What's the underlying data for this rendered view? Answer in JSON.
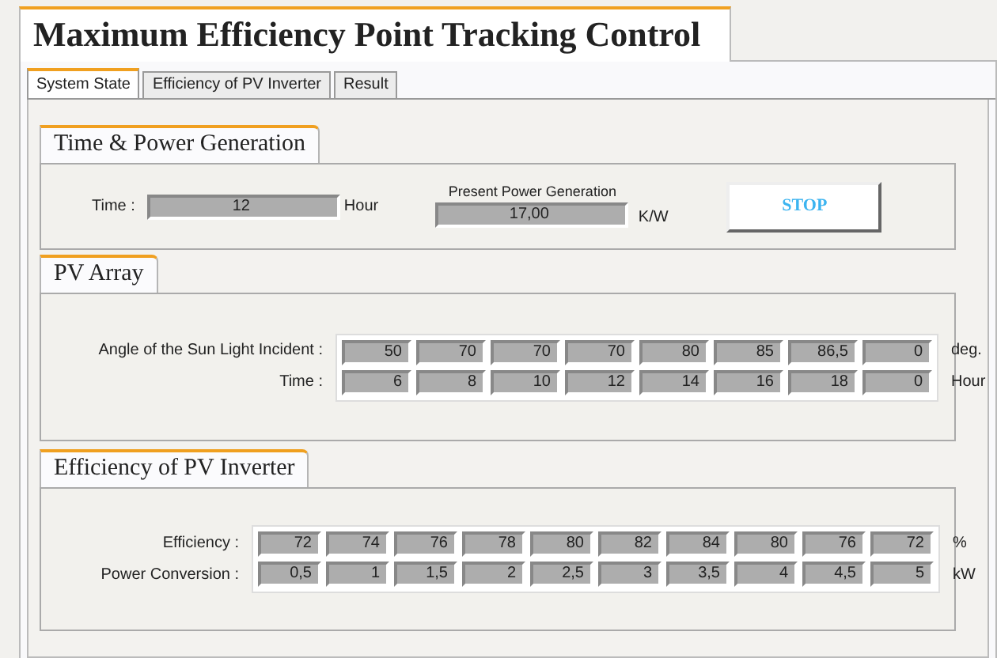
{
  "window": {
    "title": "Maximum Efficiency Point Tracking Control"
  },
  "tabs": [
    {
      "label": "System State",
      "selected": true
    },
    {
      "label": "Efficiency of PV Inverter",
      "selected": false
    },
    {
      "label": "Result",
      "selected": false
    }
  ],
  "time_power": {
    "title": "Time & Power Generation",
    "time_label": "Time :",
    "time_value": "12",
    "time_unit": "Hour",
    "power_label": "Present Power Generation",
    "power_value": "17,00",
    "power_unit": "K/W",
    "stop_button": "STOP"
  },
  "pv_array": {
    "title": "PV Array",
    "rows": [
      {
        "label": "Angle of the Sun Light Incident :",
        "values": [
          "50",
          "70",
          "70",
          "70",
          "80",
          "85",
          "86,5",
          "0"
        ],
        "unit": "deg."
      },
      {
        "label": "Time :",
        "values": [
          "6",
          "8",
          "10",
          "12",
          "14",
          "16",
          "18",
          "0"
        ],
        "unit": "Hour"
      }
    ]
  },
  "inverter": {
    "title": "Efficiency of PV Inverter",
    "rows": [
      {
        "label": "Efficiency :",
        "values": [
          "72",
          "74",
          "76",
          "78",
          "80",
          "82",
          "84",
          "80",
          "76",
          "72"
        ],
        "unit": "%"
      },
      {
        "label": "Power Conversion :",
        "values": [
          "0,5",
          "1",
          "1,5",
          "2",
          "2,5",
          "3",
          "3,5",
          "4",
          "4,5",
          "5"
        ],
        "unit": "kW"
      }
    ]
  }
}
